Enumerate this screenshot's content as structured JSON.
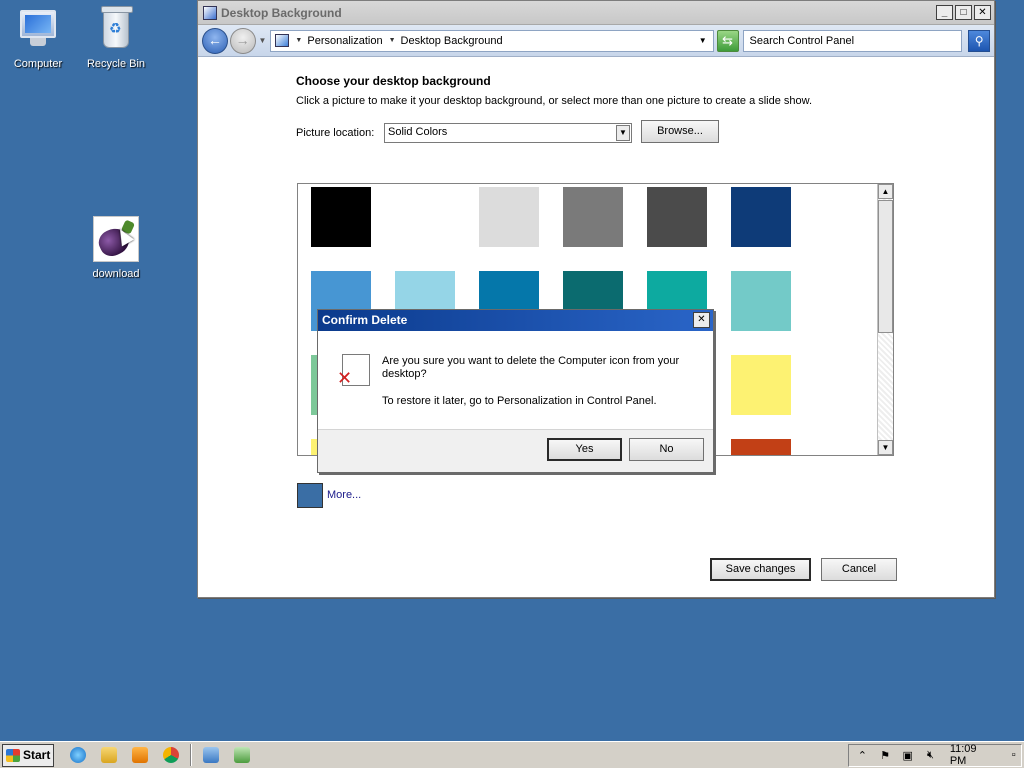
{
  "desktop": {
    "icons": [
      {
        "label": "Computer"
      },
      {
        "label": "Recycle Bin"
      },
      {
        "label": "download"
      }
    ]
  },
  "window": {
    "title": "Desktop Background",
    "breadcrumb": [
      "Personalization",
      "Desktop Background"
    ],
    "search_placeholder": "Search Control Panel"
  },
  "main": {
    "heading": "Choose your desktop background",
    "subtext": "Click a picture to make it your desktop background, or select more than one picture to create a slide show.",
    "picture_location_label": "Picture location:",
    "picture_location_value": "Solid Colors",
    "browse_label": "Browse...",
    "more_label": "More...",
    "save_label": "Save changes",
    "cancel_label": "Cancel",
    "swatch_colors": [
      "#000000",
      "#ffffff",
      "#dcdcdc",
      "#7a7a7a",
      "#4b4b4b",
      "#0e3b78",
      "#4796d3",
      "#95d5e7",
      "#0577aa",
      "#0b6b6f",
      "#0daaa0",
      "#73cac8",
      "#7dc899",
      "#ffffff",
      "#ffffff",
      "#ffffff",
      "#ffffff",
      "#fdf272",
      "#fdf272",
      "#ffffff",
      "#ffffff",
      "#ffffff",
      "#ffffff",
      "#c24016"
    ],
    "more_color": "#3a6ea5"
  },
  "dialog": {
    "title": "Confirm Delete",
    "message": "Are you sure you want to delete the Computer icon from your desktop?",
    "detail": "To restore it later, go to Personalization in Control Panel.",
    "yes_label": "Yes",
    "no_label": "No"
  },
  "taskbar": {
    "start_label": "Start",
    "clock": "11:09 PM"
  }
}
